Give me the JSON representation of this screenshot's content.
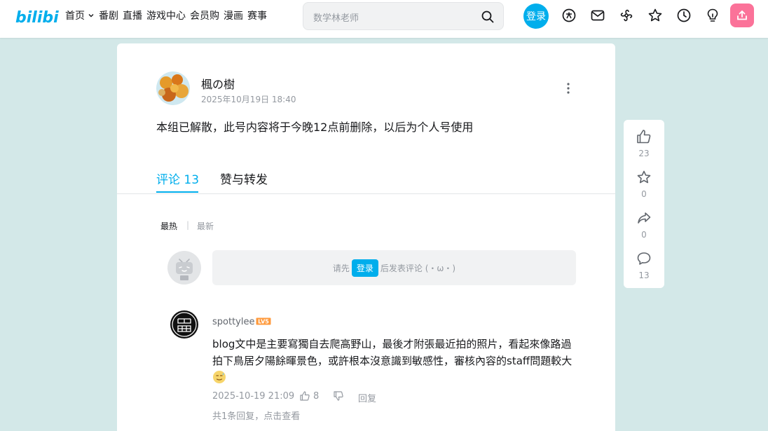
{
  "header": {
    "logo_text": "bilibili",
    "nav": [
      "首页",
      "番剧",
      "直播",
      "游戏中心",
      "会员购",
      "漫画",
      "赛事"
    ],
    "search_placeholder": "数学林老师",
    "login_label": "登录",
    "icons": [
      "vip-icon",
      "message-icon",
      "dynamic-icon",
      "favorites-icon",
      "history-icon",
      "creation-icon",
      "upload-icon"
    ]
  },
  "post": {
    "author": "楓の樹",
    "time": "2025年10月19日 18:40",
    "content": "本组已解散，此号内容将于今晚12点前删除，以后为个人号使用"
  },
  "tabs": {
    "comments": "评论 13",
    "likes": "赞与转发"
  },
  "sort": {
    "hot": "最热",
    "separator": "|",
    "new": "最新"
  },
  "comment_login": {
    "prefix": "请先",
    "button": "登录",
    "suffix": "后发表评论 (・ω・)"
  },
  "comment": {
    "user": "spottylee",
    "level": "LV5",
    "text": "blog文中是主要寫獨自去爬高野山，最後才附張最近拍的照片，看起來像路過拍下鳥居夕陽餘暉景色，或許根本沒意識到敏感性，審核內容的staff問題較大",
    "time": "2025-10-19 21:09",
    "likes": "8",
    "reply_label": "回复",
    "sub_replies": "共1条回复，点击查看"
  },
  "side": {
    "like_count": "23",
    "fav_count": "0",
    "share_count": "0",
    "comment_count": "13"
  },
  "colors": {
    "accent": "#00aeec",
    "upload": "#fb7299",
    "background": "#d3e8e8"
  }
}
